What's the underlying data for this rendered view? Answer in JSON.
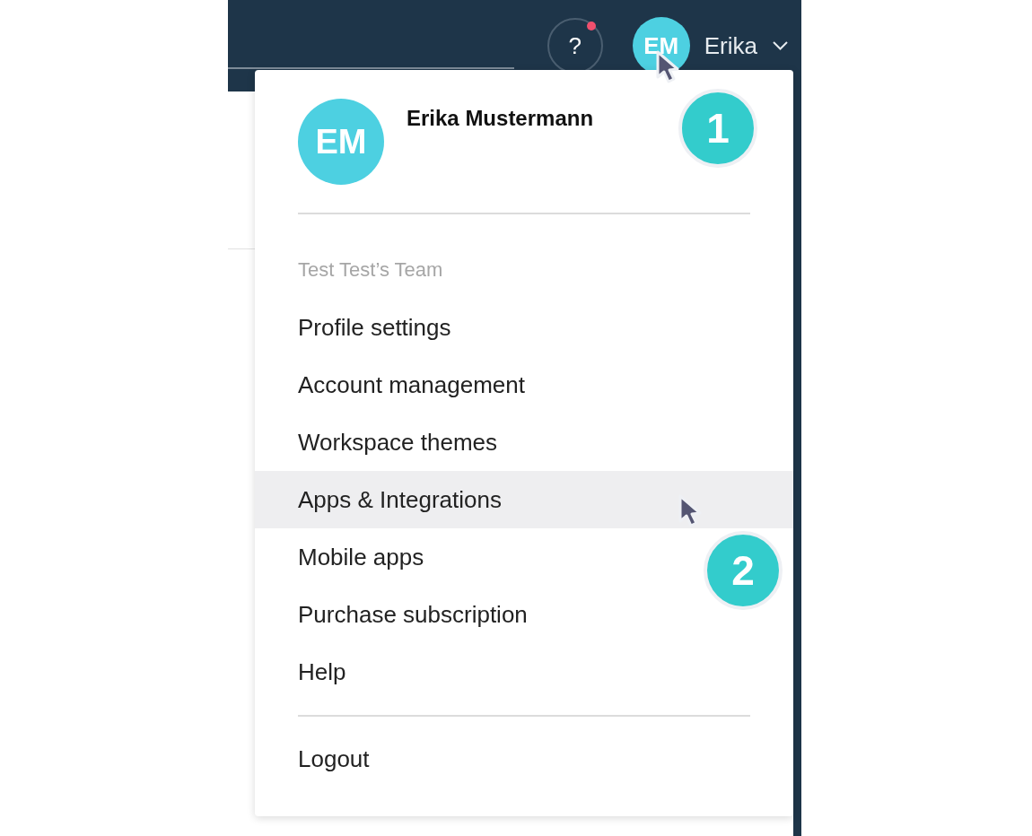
{
  "header": {
    "help_button": {
      "text": "?",
      "notification": true
    },
    "user": {
      "initials": "EM",
      "name": "Erika"
    }
  },
  "menu": {
    "profile": {
      "initials": "EM",
      "name": "Erika Mustermann"
    },
    "team_label": "Test Test’s Team",
    "items": [
      {
        "label": "Profile settings",
        "selected": false
      },
      {
        "label": "Account management",
        "selected": false
      },
      {
        "label": "Workspace themes",
        "selected": false
      },
      {
        "label": "Apps & Integrations",
        "selected": true
      },
      {
        "label": "Mobile apps",
        "selected": false
      },
      {
        "label": "Purchase subscription",
        "selected": false
      },
      {
        "label": "Help",
        "selected": false
      }
    ],
    "logout": "Logout"
  },
  "annotations": [
    {
      "text": "1"
    },
    {
      "text": "2"
    }
  ]
}
